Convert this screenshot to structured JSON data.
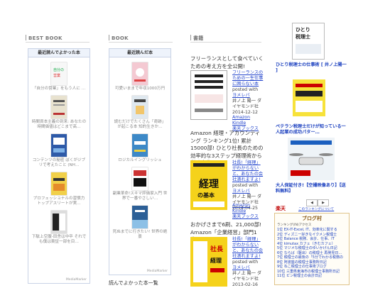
{
  "col1": {
    "heading": "BEST BOOK",
    "widget_title": "最近読んでよかった本",
    "items": [
      {
        "text": "「自分の営業」をもう人に …",
        "highlight": false,
        "cover": "#f7f7f7"
      },
      {
        "text": "時間資本主義の到来: あなたの時間価値はどこまで高…",
        "highlight": false,
        "cover": "#e8e2cf"
      },
      {
        "text": "コンテンツの秘密 ぼくがジブリで考えたこと (NH…",
        "highlight": false,
        "cover": "#2e5aa8"
      },
      {
        "text": "プロフェッショナルの習慣力 トップアスリートが実…",
        "highlight": false,
        "cover": "#f1d049"
      },
      {
        "text": "下駄上空腹-田舎は中卒 それでも僕は東証一部を目…",
        "highlight": false,
        "cover": "#ddd"
      }
    ],
    "footer": "MediaMarker"
  },
  "col2": {
    "heading": "BOOK",
    "widget_title": "最近読んだ本",
    "items": [
      {
        "text": "可愛いままで年収1000万円",
        "highlight": false,
        "cover": "#f4c9d2"
      },
      {
        "text": "読むだけでたくさん「奇跡」が起こる本 知的生きか…",
        "highlight": false,
        "cover": "#dfe8ef"
      },
      {
        "text": "ロジカルイングリッシュ",
        "highlight": false,
        "cover": "#3d89c7"
      },
      {
        "text": "副業革命!スキマ評価家入門 世界で一番やさしい…",
        "highlight": false,
        "cover": "#c33"
      },
      {
        "text": "死ぬまでに行きたい! 世界の絶景",
        "highlight": false,
        "cover": "#2c5f96"
      }
    ],
    "footer": "MediaMarker",
    "bottom_text": "読んでよかった本一覧"
  },
  "col3": {
    "heading": "書籍",
    "posts": [
      {
        "intro": "フリーランスとして食べていくための考え方を全公開!",
        "cover_title": "フリーランスのための一生仕事に困らない本",
        "cover_color": "#ffffff",
        "link_title": "フリーランスのための一生仕事に困らない本",
        "posted_with": "posted with",
        "amazlet": "ヨメレバ",
        "author": "井ノ上 陽一",
        "publisher": "ダイヤモンド社",
        "date": "2014-12-12",
        "store1": "Amazon Kindle",
        "store2": "楽天ブックス"
      },
      {
        "intro": "Amazon 経理・アカウンティング ランキング1位! 累計15000部! ひとり社長のための効率的な3ステップ経理術から税務申告まで",
        "cover_title": "経理の基本",
        "cover_color": "#f5d21b",
        "link_title": "社長!「経理」がわからないと、あなたの会社潰れますよ!",
        "posted_with": "posted with",
        "amazlet": "ヨメレバ",
        "author": "井ノ上 陽一",
        "publisher": "ダイヤモンド社",
        "date": "2014-04-25",
        "store1": "Amazon Kindle",
        "store2": "楽天ブックス"
      },
      {
        "intro": "おかげさまで6刷、21,000部! Amazon「企業経営」部門1位!",
        "cover_title": "社長!「経理」がわからないと、あなたの会社潰れますよ!",
        "cover_color": "#f5d21b",
        "link_title": "社長!「経理」がわからないと、あなたの会社潰れますよ!",
        "posted_with": "posted with",
        "amazlet": "ヨメレバ",
        "author": "井ノ上 陽一",
        "publisher": "ダイヤモンド社",
        "date": "2013-02-16",
        "store1": "",
        "store2": ""
      }
    ]
  },
  "col4": {
    "books": [
      {
        "title": "ひとり税理士の仕事術 [ 井ノ上陽一 ]",
        "cover_color": "#ffffff"
      },
      {
        "title": "ベテラン税理士だけが知っている一人起業の成功パター…",
        "cover_color": "#f7e23a"
      },
      {
        "title": "大人保証付き!【空撮映像あり】【送料無料】",
        "cover_color": "#eef3f7"
      }
    ],
    "rakuten_label": "楽天",
    "prev_label": "◀",
    "next_label": "▶",
    "more_label": "このランキングについて",
    "blogmura": {
      "title": "ブログ村",
      "subtitle": "ランキング(IN)アクセス",
      "items": [
        "1位 EX-IT-Excel, IT、効率化に関する",
        "2位 ディズニー好きなイクメン税理士",
        "3位 Balance 税務、会計、仕事、IT",
        "4位 kimutax カフェ（きむカフェ）",
        "5位 マジメな税理士のゆいかげん日記",
        "6位 ならば（駆出）の税理士 再発見日…",
        "7位 税理士の最後の「5分でわかる税務の",
        "8位 阿波座の税理士事務所日記",
        "9位 ねこ税理士の仕事術ブログ",
        "10位 三重県東海市の税理士事務所日記",
        "11位 ピン税理士の会計日記"
      ]
    }
  },
  "colors": {
    "link": "#0033cc",
    "rakuten": "#bf0000",
    "widget_border": "#c9d3e6"
  }
}
